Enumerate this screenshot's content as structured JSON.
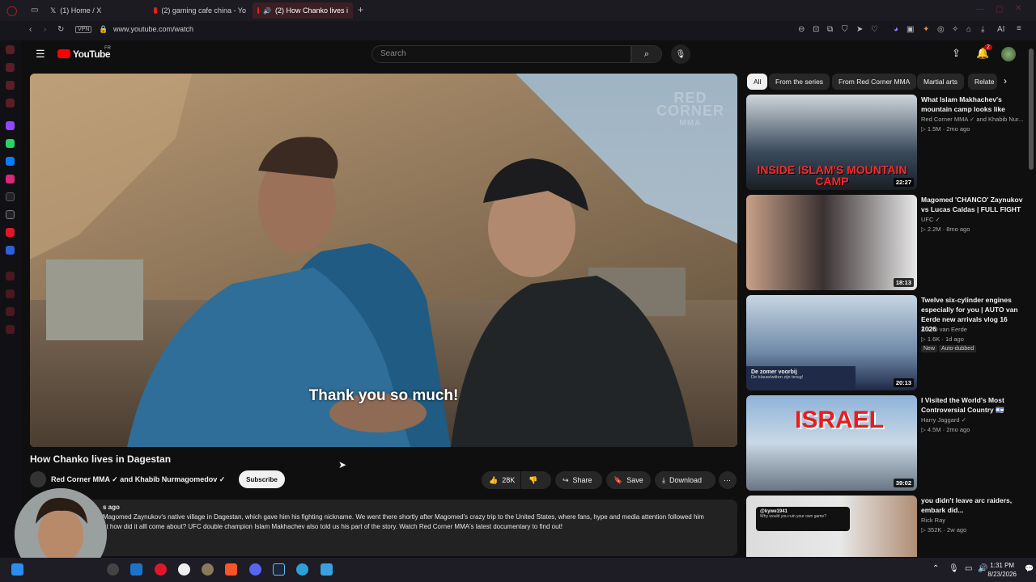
{
  "browser": {
    "tabs": [
      {
        "label": "(1) Home / X",
        "active": false
      },
      {
        "label": "(2) gaming cafe china - Yo",
        "active": false
      },
      {
        "label": "(2) How Chanko lives i",
        "active": true
      }
    ],
    "url": "www.youtube.com/watch",
    "vpn_label": "VPN"
  },
  "youtube": {
    "logo_text": "YouTube",
    "region": "FR",
    "search_placeholder": "Search",
    "notification_count": "2"
  },
  "video": {
    "subtitle": "Thank you so much!",
    "watermark_line1": "RED",
    "watermark_line2": "CORNER",
    "watermark_line3": "MMA",
    "title": "How Chanko lives in Dagestan",
    "channel": "Red Corner MMA ✓ and Khabib Nurmagomedov ✓",
    "subscribe_label": "Subscribe",
    "likes": "28K",
    "share_label": "Share",
    "save_label": "Save",
    "download_label": "Download",
    "desc_age": "s ago",
    "desc_line1": "Magomed Zaynukov's native village in Dagestan, which gave him his fighting nickname. We went there shortly after Magomed's crazy trip to the United States, where fans, hype and media attention followed him",
    "desc_line2": "ut how did it alll come about? UFC double champion Islam Makhachev also told us his part of the story. Watch Red Corner MMA's latest documentary to find out!"
  },
  "chips": [
    "All",
    "From the series",
    "From Red Corner MMA",
    "Martial arts",
    "Relate"
  ],
  "recommendations": [
    {
      "title": "What Islam Makhachev's mountain camp looks like",
      "channel": "Red Corner MMA ✓ and Khabib Nur...",
      "meta": "▷ 1.5M · 2mo ago",
      "duration": "22:27",
      "thumb_text": "INSIDE ISLAM'S MOUNTAIN CAMP",
      "thumb_color": "#3a4a5c"
    },
    {
      "title": "Magomed 'CHANCO' Zaynukov vs Lucas Caldas | FULL FIGHT",
      "channel": "UFC ✓",
      "meta": "▷ 2.2M · 8mo ago",
      "duration": "18:13",
      "thumb_text": "",
      "thumb_color": "#3a3232"
    },
    {
      "title": "Twelve six-cylinder engines especially for you | AUTO van Eerde new arrivals vlog 16 2026",
      "channel": "AUTO van Eerde",
      "meta": "▷ 1.6K · 1d ago",
      "duration": "20:13",
      "badge1": "New",
      "badge2": "Auto-dubbed",
      "thumb_text": "De zomer voorbij",
      "thumb_sub": "De blauw/witten zijn terug!",
      "thumb_color": "#6f8aa8"
    },
    {
      "title": "I Visited the World's Most Controversial Country 🇮🇱",
      "channel": "Harry Jaggard ✓",
      "meta": "▷ 4.5M · 2mo ago",
      "duration": "39:02",
      "thumb_text": "ISRAEL",
      "thumb_color": "#8fb3d9"
    },
    {
      "title": "you didn't leave arc raiders, embark did...",
      "channel": "Rick Ray",
      "meta": "▷ 352K · 2w ago",
      "duration": "",
      "thumb_text": "@kywe1941",
      "thumb_sub": "Why would you ruin your own game?",
      "thumb_color": "#dcdcdc"
    }
  ],
  "taskbar": {
    "time": "1:31 PM",
    "date": "8/23/2026"
  }
}
